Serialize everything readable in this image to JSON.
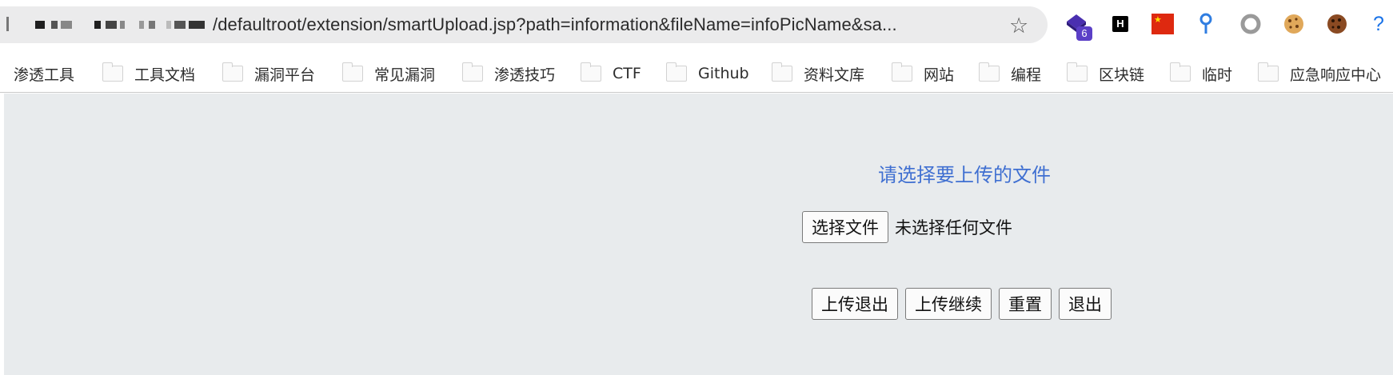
{
  "address_bar": {
    "url_visible": "/defaultroot/extension/smartUpload.jsp?path=information&fileName=infoPicName&sa...",
    "bookmark_icon": "star-icon"
  },
  "extensions": [
    {
      "name": "shield-extension-icon",
      "badge": "6"
    },
    {
      "name": "hackbar-extension-icon",
      "label": "H"
    },
    {
      "name": "china-flag-extension-icon"
    },
    {
      "name": "location-pin-extension-icon"
    },
    {
      "name": "circle-extension-icon"
    },
    {
      "name": "cookie-extension-icon"
    },
    {
      "name": "cookie-editor-extension-icon"
    },
    {
      "name": "help-icon",
      "label": "?"
    }
  ],
  "bookmarks": [
    {
      "label": "渗透工具",
      "folder": false
    },
    {
      "label": "工具文档",
      "folder": true
    },
    {
      "label": "漏洞平台",
      "folder": true
    },
    {
      "label": "常见漏洞",
      "folder": true
    },
    {
      "label": "渗透技巧",
      "folder": true
    },
    {
      "label": "CTF",
      "folder": true
    },
    {
      "label": "Github",
      "folder": true
    },
    {
      "label": "资料文库",
      "folder": true
    },
    {
      "label": "网站",
      "folder": true
    },
    {
      "label": "编程",
      "folder": true
    },
    {
      "label": "区块链",
      "folder": true
    },
    {
      "label": "临时",
      "folder": true
    },
    {
      "label": "应急响应中心",
      "folder": true
    }
  ],
  "upload_form": {
    "title": "请选择要上传的文件",
    "choose_file_label": "选择文件",
    "file_status": "未选择任何文件",
    "buttons": {
      "upload_exit": "上传退出",
      "upload_continue": "上传继续",
      "reset": "重置",
      "exit": "退出"
    }
  },
  "colors": {
    "page_background": "#e8ebed",
    "title_color": "#3f6fd1",
    "urlbar_background": "#ebebec"
  }
}
